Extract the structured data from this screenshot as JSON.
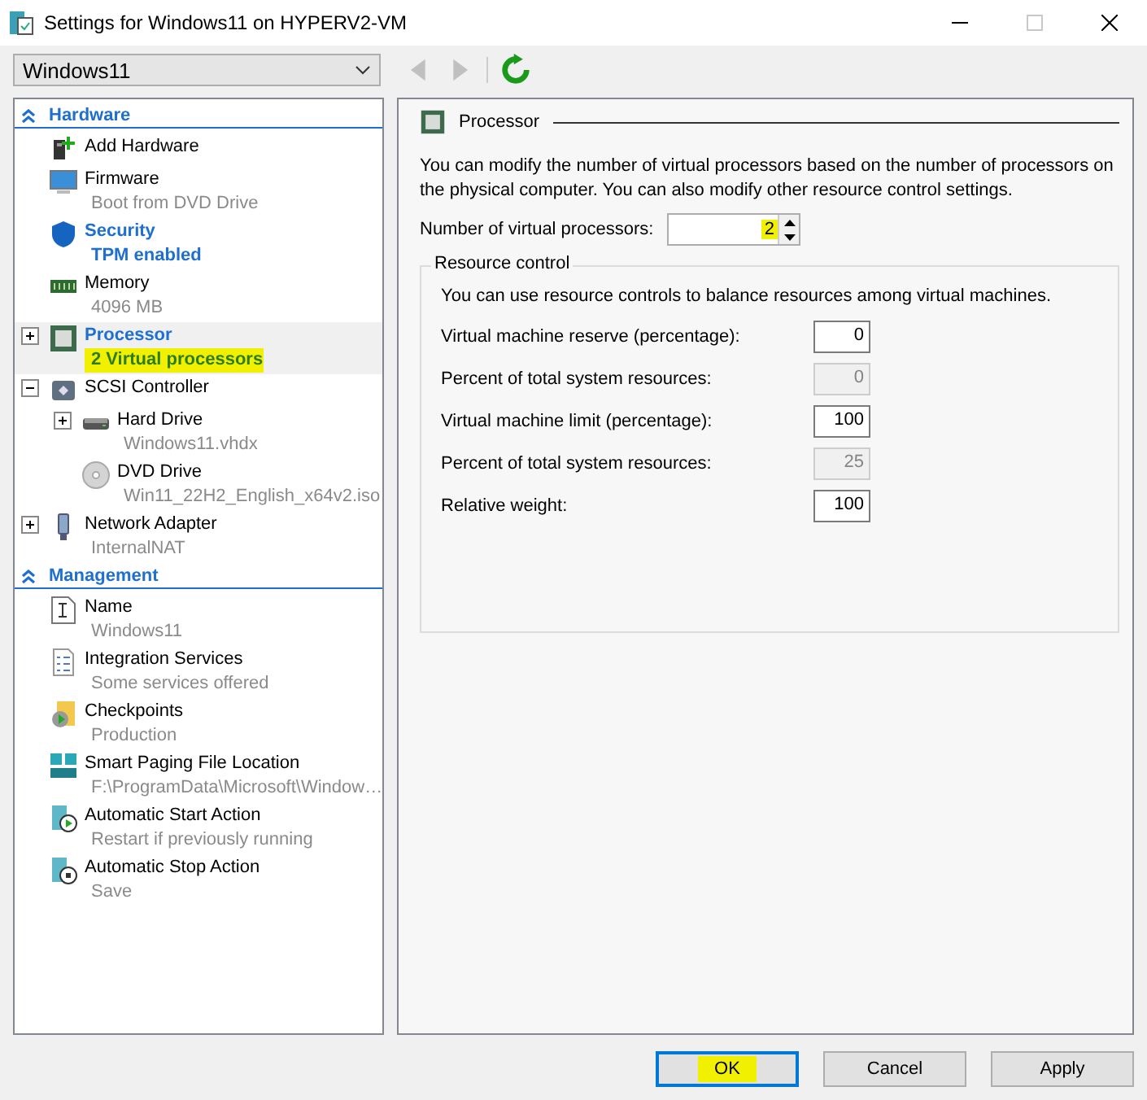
{
  "window": {
    "title": "Settings for Windows11 on HYPERV2-VM"
  },
  "vm_selector": {
    "value": "Windows11"
  },
  "toolbar": [
    {
      "kind": "back",
      "disabled": true
    },
    {
      "kind": "forward",
      "disabled": true
    },
    {
      "kind": "refresh",
      "disabled": false
    }
  ],
  "sidebar": {
    "sections": [
      {
        "title": "Hardware",
        "expanded": true,
        "items": [
          {
            "title": "Add Hardware",
            "selected": false,
            "emphasized": false
          },
          {
            "title": "Firmware",
            "subtitle": "Boot from DVD Drive",
            "selected": false,
            "emphasized": false,
            "highlighted": false
          },
          {
            "title": "Security",
            "subtitle": "TPM enabled",
            "selected": false,
            "emphasized": true,
            "highlighted": false
          },
          {
            "title": "Memory",
            "subtitle": "4096 MB",
            "selected": false,
            "emphasized": false,
            "highlighted": false
          },
          {
            "title": "Processor",
            "subtitle": "2 Virtual processors",
            "selected": true,
            "emphasized": true,
            "highlighted": true,
            "expanded": false
          },
          {
            "title": "SCSI Controller",
            "selected": false,
            "emphasized": false,
            "expanded": true,
            "children": [
              {
                "title": "Hard Drive",
                "subtitle": "Windows11.vhdx",
                "selected": false,
                "emphasized": false,
                "highlighted": false,
                "expanded": false
              },
              {
                "title": "DVD Drive",
                "subtitle": "Win11_22H2_English_x64v2.iso",
                "selected": false,
                "emphasized": false,
                "highlighted": false
              }
            ]
          },
          {
            "title": "Network Adapter",
            "subtitle": "InternalNAT",
            "selected": false,
            "emphasized": false,
            "highlighted": false,
            "expanded": false
          }
        ]
      },
      {
        "title": "Management",
        "expanded": true,
        "items": [
          {
            "title": "Name",
            "subtitle": "Windows11",
            "selected": false,
            "emphasized": false,
            "highlighted": false
          },
          {
            "title": "Integration Services",
            "subtitle": "Some services offered",
            "selected": false,
            "emphasized": false,
            "highlighted": false
          },
          {
            "title": "Checkpoints",
            "subtitle": "Production",
            "selected": false,
            "emphasized": false,
            "highlighted": false
          },
          {
            "title": "Smart Paging File Location",
            "subtitle": "F:\\ProgramData\\Microsoft\\Window…",
            "selected": false,
            "emphasized": false,
            "highlighted": false
          },
          {
            "title": "Automatic Start Action",
            "subtitle": "Restart if previously running",
            "selected": false,
            "emphasized": false,
            "highlighted": false
          },
          {
            "title": "Automatic Stop Action",
            "subtitle": "Save",
            "selected": false,
            "emphasized": false,
            "highlighted": false
          }
        ]
      }
    ]
  },
  "panel": {
    "title": "Processor",
    "description": "You can modify the number of virtual processors based on the number of processors on the physical computer. You can also modify other resource control settings.",
    "processor_count": {
      "label": "Number of virtual processors:",
      "value": "2",
      "highlighted": true
    },
    "resource_control": {
      "title": "Resource control",
      "description": "You can use resource controls to balance resources among virtual machines.",
      "fields": [
        {
          "label": "Virtual machine reserve (percentage):",
          "value": "0",
          "disabled": false
        },
        {
          "label": "Percent of total system resources:",
          "value": "0",
          "disabled": true
        },
        {
          "label": "Virtual machine limit (percentage):",
          "value": "100",
          "disabled": false
        },
        {
          "label": "Percent of total system resources:",
          "value": "25",
          "disabled": true
        },
        {
          "label": "Relative weight:",
          "value": "100",
          "disabled": false
        }
      ]
    }
  },
  "buttons": [
    {
      "label": "OK",
      "default": true,
      "highlighted": true
    },
    {
      "label": "Cancel",
      "default": false,
      "highlighted": false
    },
    {
      "label": "Apply",
      "default": false,
      "highlighted": false
    }
  ]
}
